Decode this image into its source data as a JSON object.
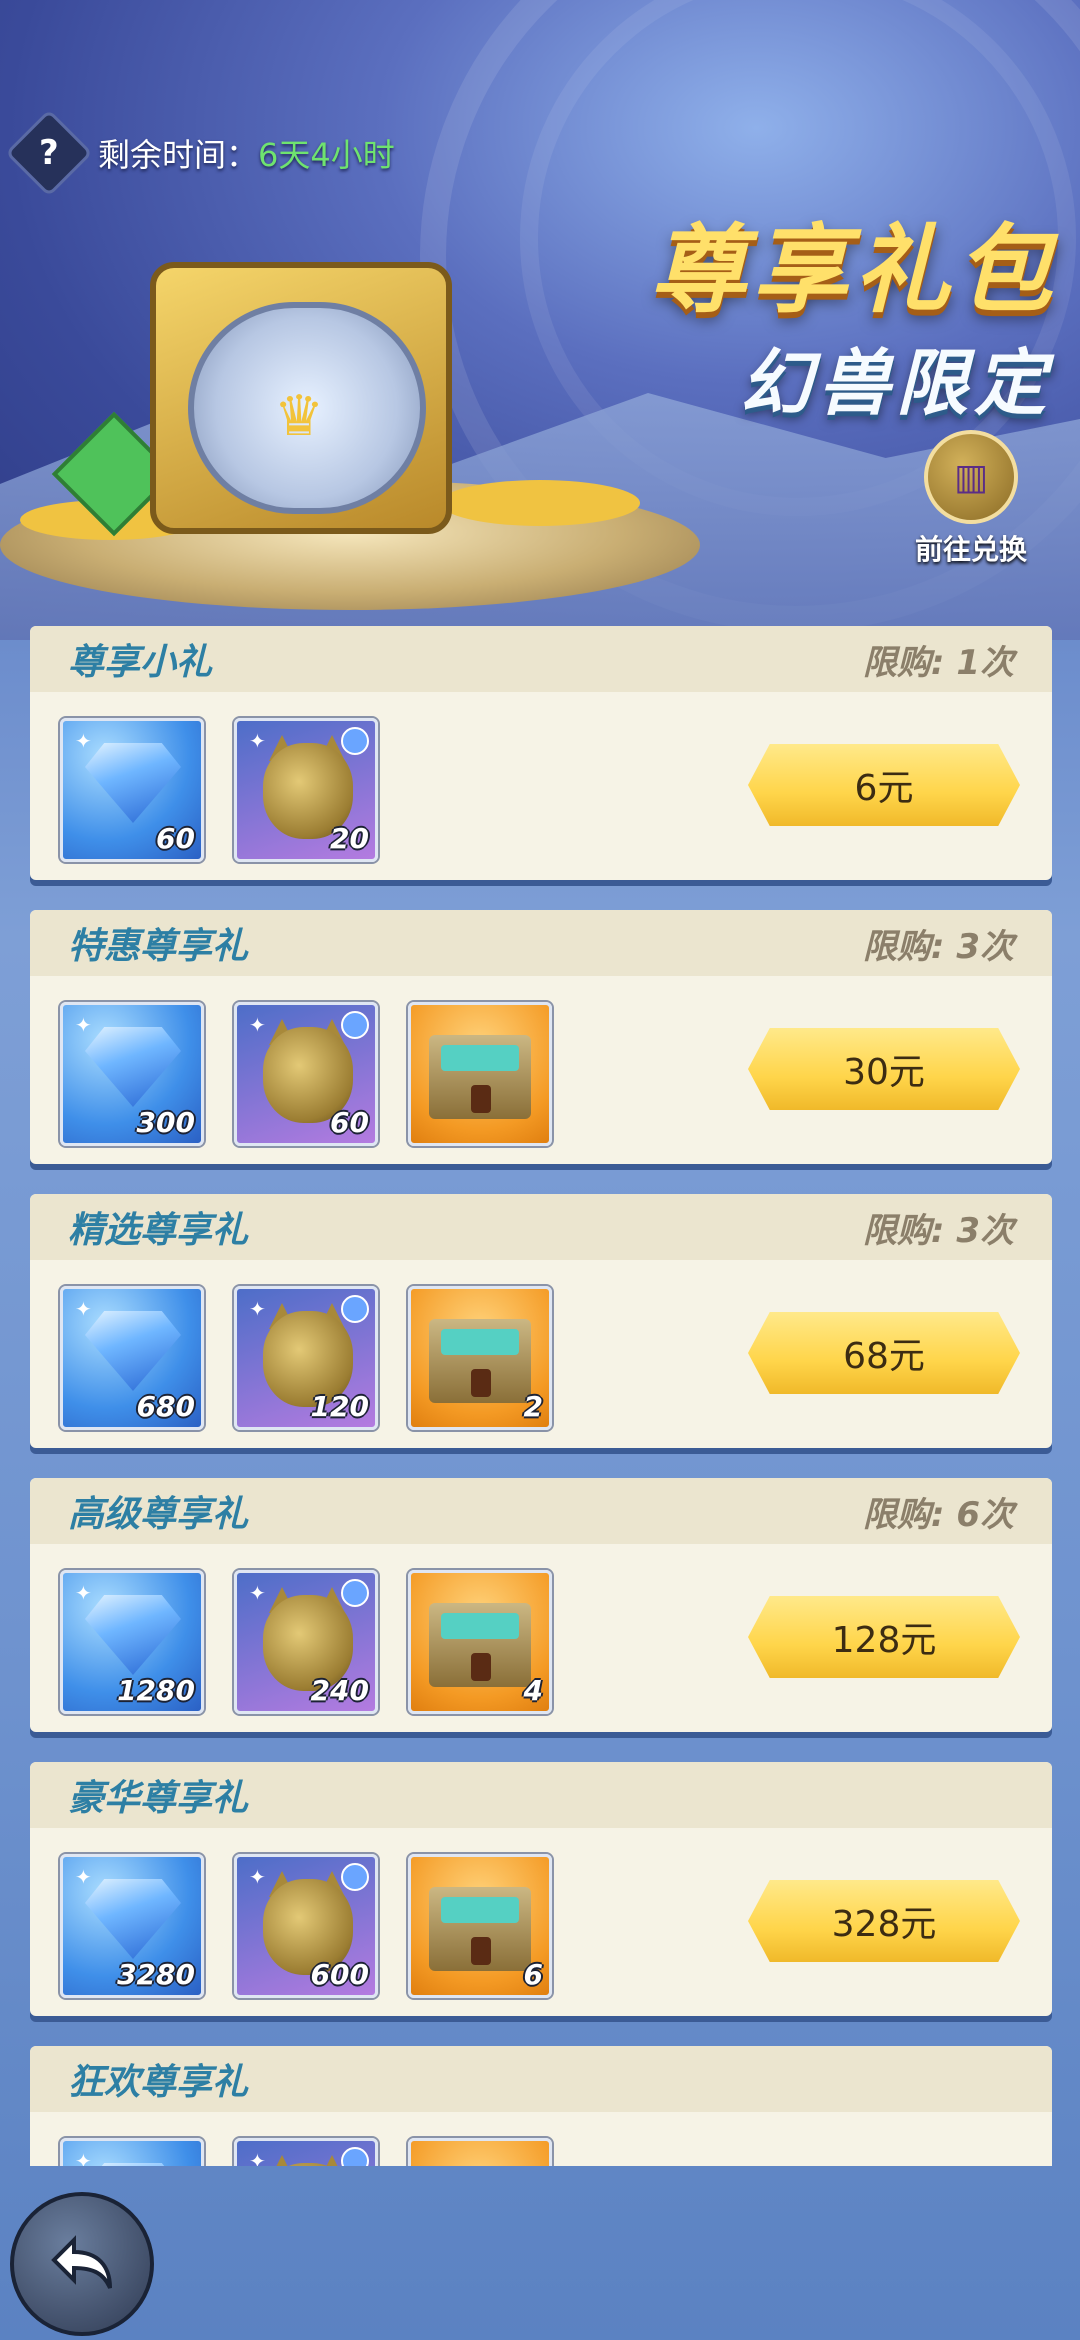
{
  "header": {
    "timer_label": "剩余时间：",
    "timer_value": "6天4小时",
    "title_main": "尊享礼包",
    "title_sub": "幻兽限定",
    "exchange_label": "前往兑换"
  },
  "packages": [
    {
      "name": "尊享小礼",
      "limit": "限购: 1次",
      "price": "6元",
      "items": [
        {
          "type": "diamond",
          "qty": "60"
        },
        {
          "type": "cat",
          "qty": "20"
        }
      ]
    },
    {
      "name": "特惠尊享礼",
      "limit": "限购: 3次",
      "price": "30元",
      "items": [
        {
          "type": "diamond",
          "qty": "300"
        },
        {
          "type": "cat",
          "qty": "60"
        },
        {
          "type": "chest",
          "qty": ""
        }
      ]
    },
    {
      "name": "精选尊享礼",
      "limit": "限购: 3次",
      "price": "68元",
      "items": [
        {
          "type": "diamond",
          "qty": "680"
        },
        {
          "type": "cat",
          "qty": "120"
        },
        {
          "type": "chest",
          "qty": "2"
        }
      ]
    },
    {
      "name": "高级尊享礼",
      "limit": "限购: 6次",
      "price": "128元",
      "items": [
        {
          "type": "diamond",
          "qty": "1280"
        },
        {
          "type": "cat",
          "qty": "240"
        },
        {
          "type": "chest",
          "qty": "4"
        }
      ]
    },
    {
      "name": "豪华尊享礼",
      "limit": "",
      "price": "328元",
      "items": [
        {
          "type": "diamond",
          "qty": "3280"
        },
        {
          "type": "cat",
          "qty": "600"
        },
        {
          "type": "chest",
          "qty": "6"
        }
      ]
    },
    {
      "name": "狂欢尊享礼",
      "limit": "",
      "price": "",
      "items": [
        {
          "type": "diamond",
          "qty": ""
        },
        {
          "type": "cat",
          "qty": ""
        },
        {
          "type": "chest",
          "qty": ""
        }
      ]
    }
  ],
  "icons": {
    "help": "question-icon",
    "diamond": "diamond-icon",
    "cat": "golden-cat-icon",
    "chest": "treasure-chest-icon",
    "exchange": "shop-icon",
    "back": "back-arrow-icon"
  }
}
